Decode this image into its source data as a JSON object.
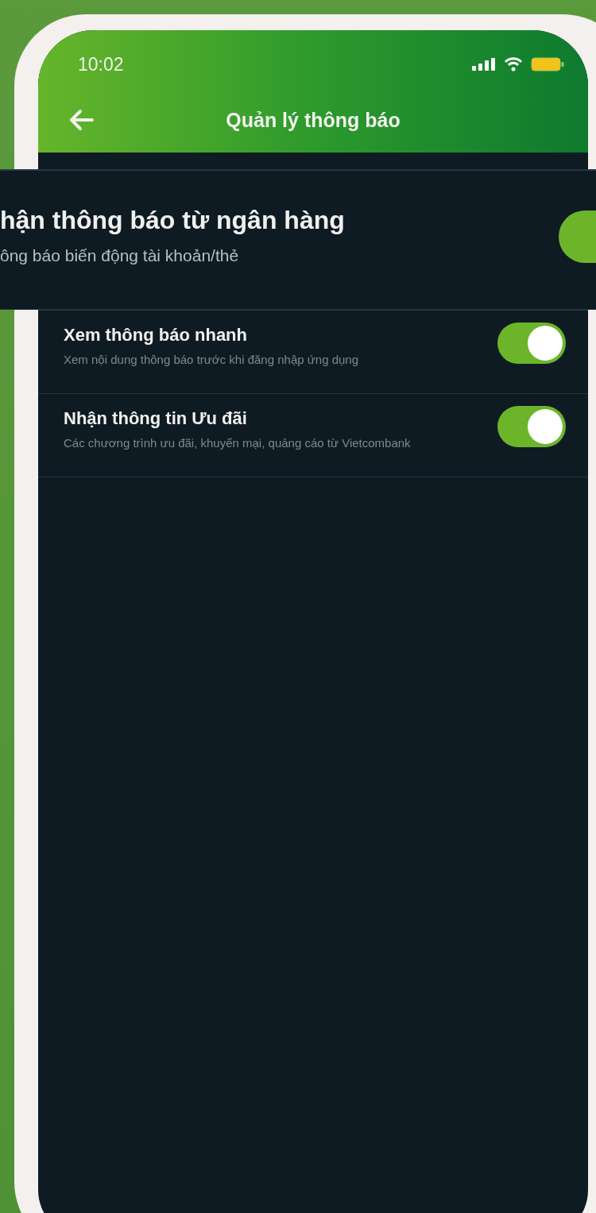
{
  "status_bar": {
    "time": "10:02"
  },
  "header": {
    "title": "Quản lý thông báo"
  },
  "highlight": {
    "title": "hận thông báo từ ngân hàng",
    "subtitle": "ông báo biến động tài khoản/thẻ",
    "on": true
  },
  "settings": [
    {
      "title": "Xem thông báo nhanh",
      "subtitle": "Xem nội dung thông báo trước khi đăng nhập ứng dụng",
      "on": true
    },
    {
      "title": "Nhận thông tin Ưu đãi",
      "subtitle": "Các chương trình ưu đãi, khuyến mại, quảng cáo từ Vietcombank",
      "on": true
    }
  ]
}
